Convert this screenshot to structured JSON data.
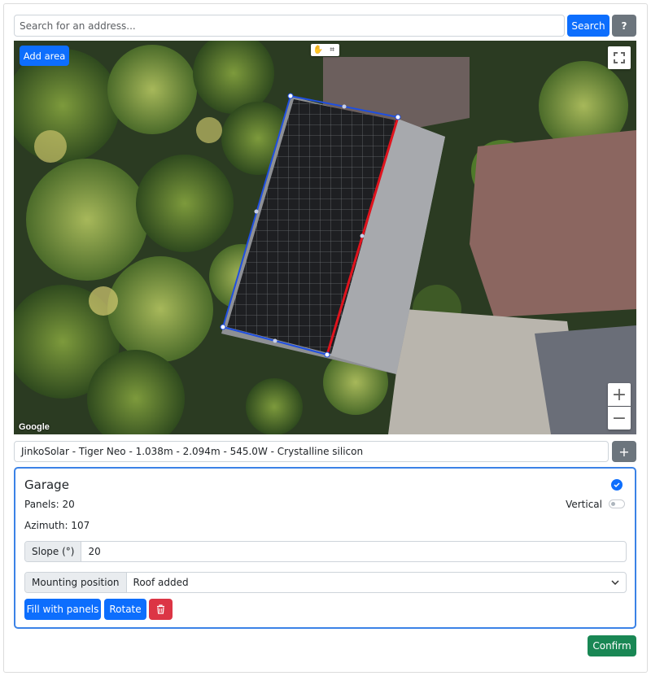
{
  "search": {
    "placeholder": "Search for an address...",
    "search_label": "Search",
    "help_label": "?"
  },
  "map": {
    "add_area_label": "Add area",
    "zoom_in_label": "+",
    "zoom_out_label": "−",
    "attribution": "Google",
    "area_outline_color": "#1f4fe0",
    "azimuth_edge_color": "#e0131d"
  },
  "panel_model": {
    "value": "JinkoSolar - Tiger Neo - 1.038m - 2.094m - 545.0W - Crystalline silicon",
    "add_label": "+"
  },
  "area_card": {
    "title": "Garage",
    "panels_text": "Panels: 20",
    "vertical_label": "Vertical",
    "vertical_enabled": false,
    "azimuth_text": "Azimuth: 107",
    "slope_label": "Slope (°)",
    "slope_value": "20",
    "mounting_label": "Mounting position",
    "mounting_value": "Roof added",
    "fill_label": "Fill with panels",
    "rotate_label": "Rotate"
  },
  "footer": {
    "confirm_label": "Confirm"
  },
  "colors": {
    "primary": "#0d6efd",
    "secondary": "#6c757d",
    "danger": "#dc3545",
    "success": "#198754"
  }
}
